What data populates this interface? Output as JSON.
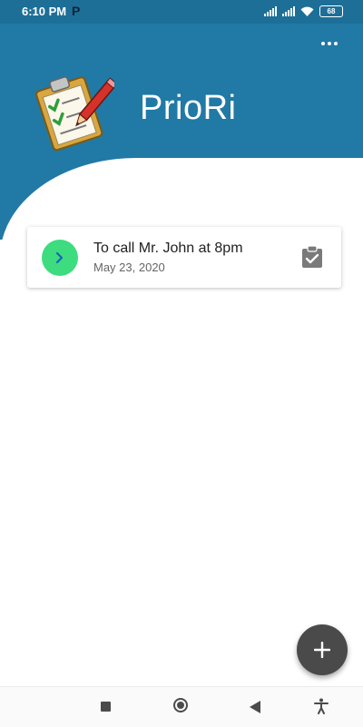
{
  "status_bar": {
    "time": "6:10 PM",
    "notification_letter": "P",
    "battery": "68"
  },
  "header": {
    "app_title": "PrioRi",
    "more_icon": "more-horiz-icon",
    "background_color": "#2179a6"
  },
  "tasks": [
    {
      "title": "To call Mr. John at 8pm",
      "date": "May 23, 2020",
      "lead_icon": "chevron-right-icon",
      "trail_icon": "clipboard-check-icon",
      "lead_color": "#3ddc7e"
    }
  ],
  "fab": {
    "icon": "plus-icon"
  },
  "nav_bar": {
    "icons": [
      "recents-square-icon",
      "home-circle-icon",
      "back-triangle-icon",
      "accessibility-icon"
    ]
  }
}
